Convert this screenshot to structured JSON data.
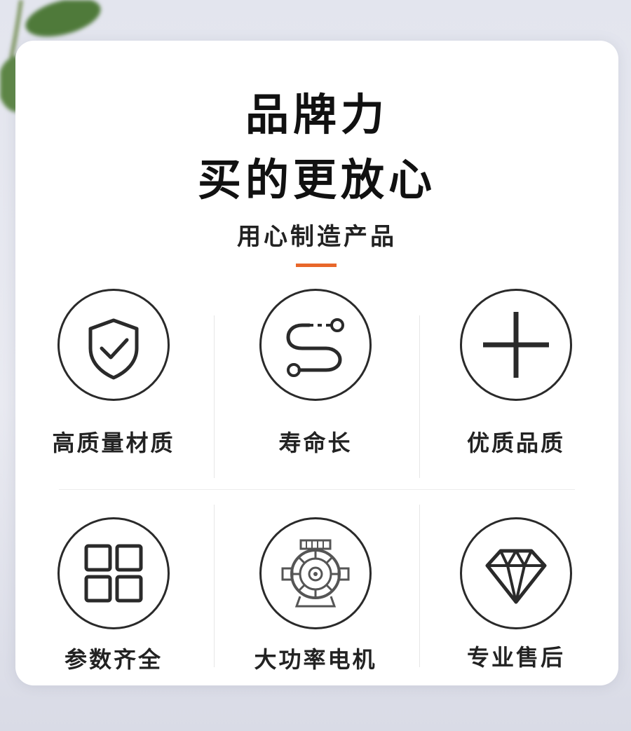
{
  "heading": {
    "line1": "品牌力",
    "line2": "买的更放心"
  },
  "subheading": "用心制造产品",
  "colors": {
    "accent": "#e8672a",
    "icon_stroke": "#2a2a2a",
    "card": "#ffffff"
  },
  "features": [
    {
      "label": "高质量材质",
      "icon": "shield-check-icon"
    },
    {
      "label": "寿命长",
      "icon": "route-path-icon"
    },
    {
      "label": "优质品质",
      "icon": "plus-icon"
    },
    {
      "label": "参数齐全",
      "icon": "grid-squares-icon"
    },
    {
      "label": "大功率电机",
      "icon": "motor-icon"
    },
    {
      "label": "专业售后",
      "icon": "diamond-icon"
    }
  ]
}
